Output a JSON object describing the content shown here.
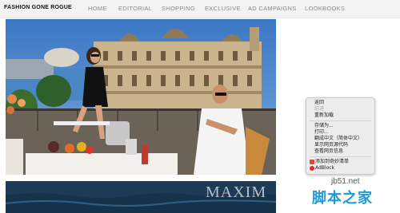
{
  "site": {
    "logo": "FASHION GONE ROGUE"
  },
  "nav": {
    "items": [
      "HOME",
      "EDITORIAL",
      "SHOPPING",
      "EXCLUSIVE",
      "AD CAMPAIGNS",
      "LOOKBOOKS"
    ]
  },
  "second_image": {
    "text": "MAXIM"
  },
  "context_menu": {
    "items": [
      {
        "label": "返回",
        "enabled": true
      },
      {
        "label": "前进",
        "enabled": false
      },
      {
        "label": "重新加载",
        "enabled": true
      },
      {
        "label": "存储为...",
        "enabled": true
      },
      {
        "label": "打印...",
        "enabled": true
      },
      {
        "label": "翻成中文（简体中文）",
        "enabled": true
      },
      {
        "label": "显示网页源代码",
        "enabled": true
      },
      {
        "label": "查看网页信息",
        "enabled": true
      },
      {
        "label": "添加到奇妙清单",
        "enabled": true,
        "icon": "wunderlist-icon",
        "icon_color": "#e8453c"
      },
      {
        "label": "AdBlock",
        "enabled": true,
        "icon": "adblock-icon",
        "icon_color": "#d9302c"
      }
    ]
  },
  "watermark": {
    "domain": "jb51.net",
    "brand": "脚本之家"
  }
}
